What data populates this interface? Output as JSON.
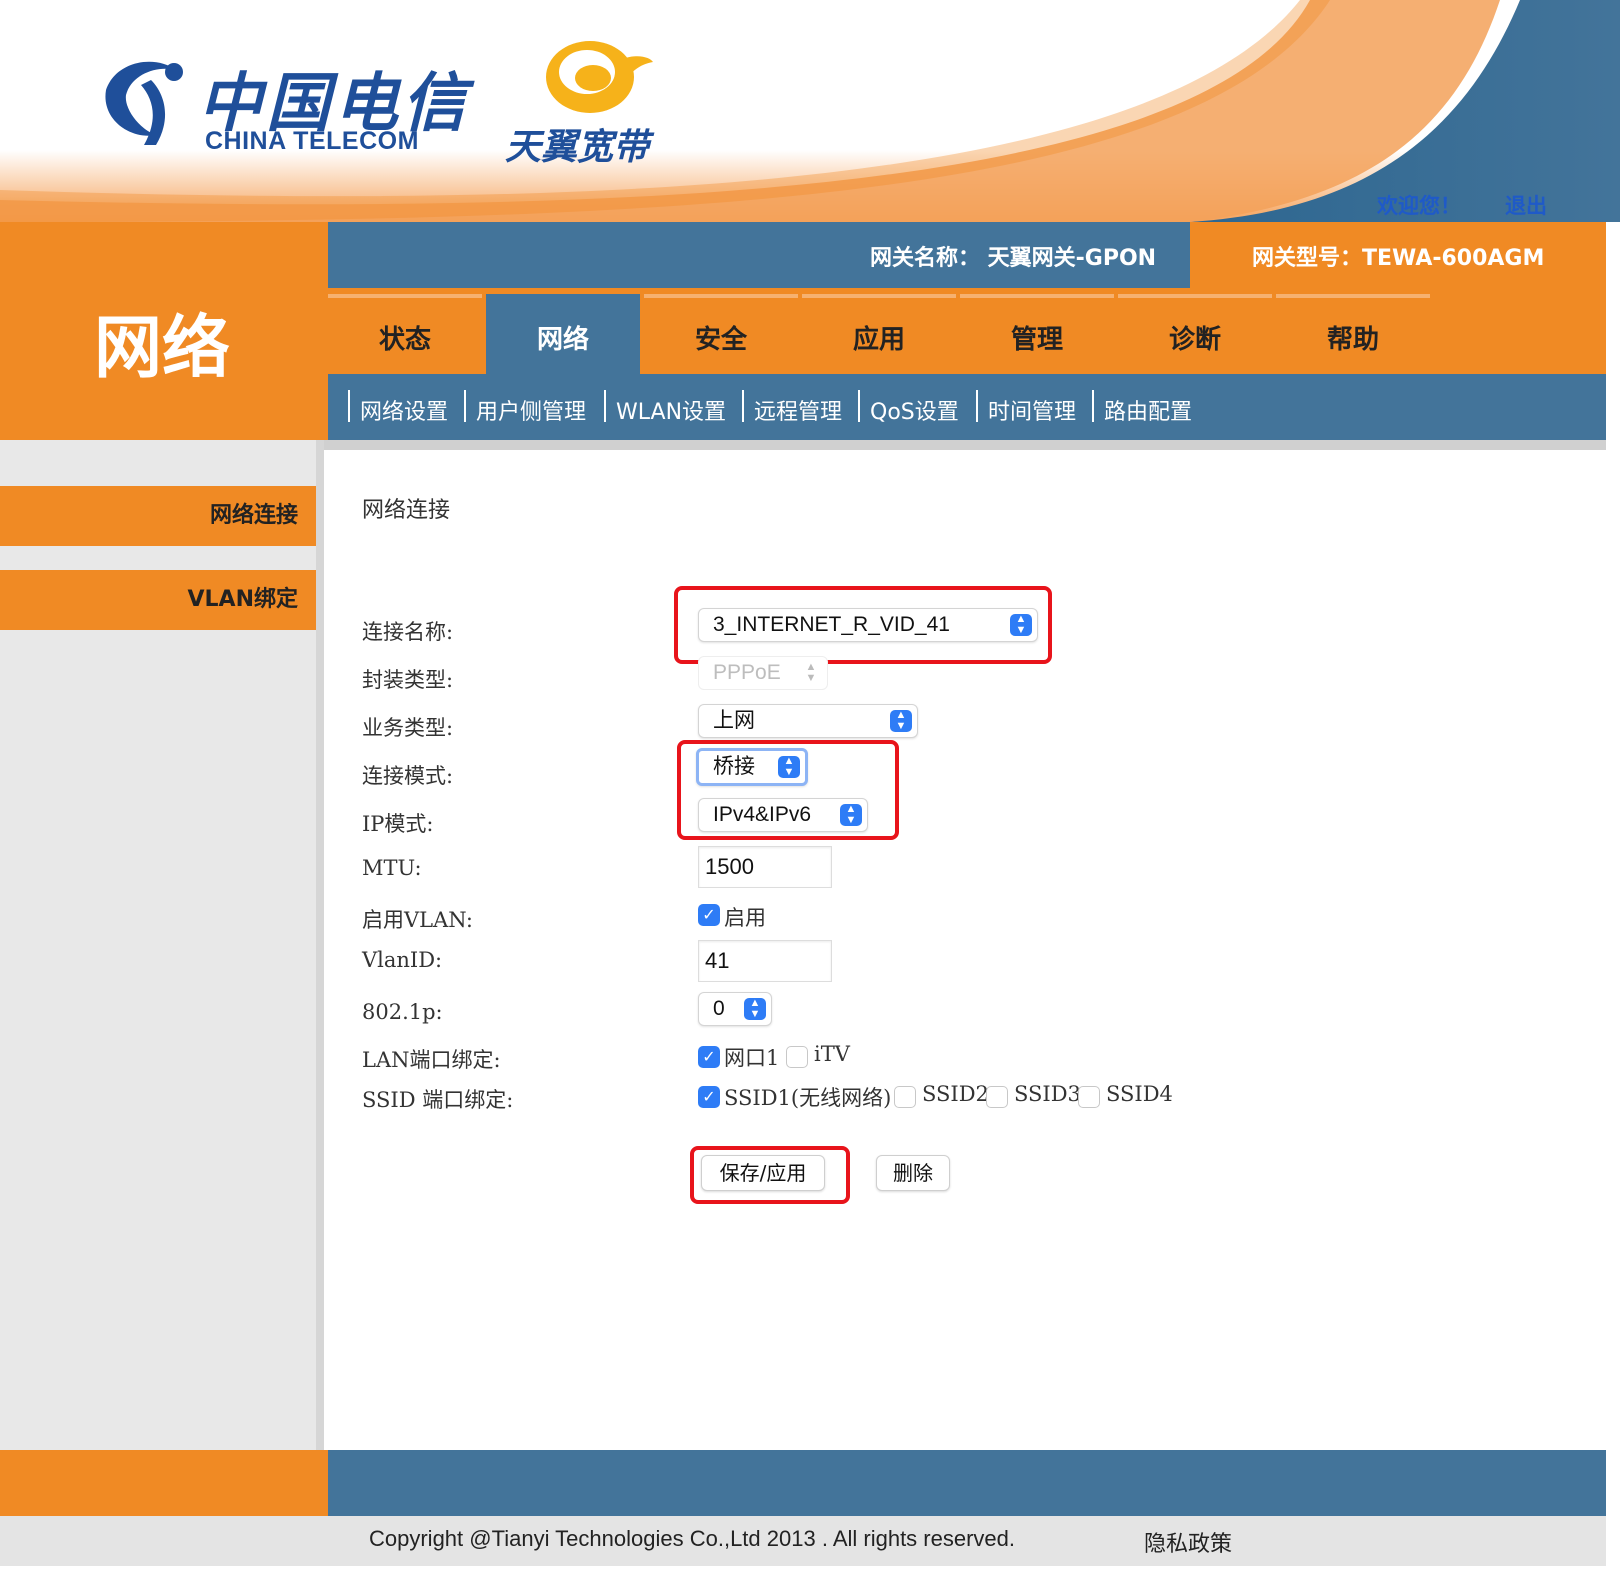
{
  "header": {
    "brand_cn": "中国电信",
    "brand_en": "CHINA TELECOM",
    "brand_sub": "天翼宽带",
    "welcome": "欢迎您！",
    "logout": "退出"
  },
  "info_bar": {
    "gateway_name": "网关名称：  天翼网关-GPON",
    "gateway_model": "网关型号：TEWA-600AGM"
  },
  "section_title": "网络",
  "tabs": [
    {
      "label": "状态"
    },
    {
      "label": "网络"
    },
    {
      "label": "安全"
    },
    {
      "label": "应用"
    },
    {
      "label": "管理"
    },
    {
      "label": "诊断"
    },
    {
      "label": "帮助"
    }
  ],
  "subnav": [
    {
      "label": "网络设置"
    },
    {
      "label": "用户侧管理"
    },
    {
      "label": "WLAN设置"
    },
    {
      "label": "远程管理"
    },
    {
      "label": "QoS设置"
    },
    {
      "label": "时间管理"
    },
    {
      "label": "路由配置"
    }
  ],
  "sidebar": [
    {
      "label": "网络连接"
    },
    {
      "label": "VLAN绑定"
    }
  ],
  "form": {
    "heading": "网络连接",
    "connection_name": {
      "label": "连接名称:",
      "value": "3_INTERNET_R_VID_41"
    },
    "encap_type": {
      "label": "封装类型:",
      "value": "PPPoE"
    },
    "service_type": {
      "label": "业务类型:",
      "value": "上网"
    },
    "connection_mode": {
      "label": "连接模式:",
      "value": "桥接"
    },
    "ip_mode": {
      "label": "IP模式:",
      "value": "IPv4&IPv6"
    },
    "mtu": {
      "label": "MTU:",
      "value": "1500"
    },
    "enable_vlan": {
      "label": "启用VLAN:",
      "option": "启用",
      "checked": true
    },
    "vlan_id": {
      "label": "VlanID:",
      "value": "41"
    },
    "p8021": {
      "label": "802.1p:",
      "value": "0"
    },
    "lan_bind": {
      "label": "LAN端口绑定:",
      "options": [
        {
          "label": "网口1",
          "checked": true
        },
        {
          "label": "iTV",
          "checked": false
        }
      ]
    },
    "ssid_bind": {
      "label": "SSID 端口绑定:",
      "options": [
        {
          "label": "SSID1(无线网络)",
          "checked": true
        },
        {
          "label": "SSID2",
          "checked": false
        },
        {
          "label": "SSID3",
          "checked": false
        },
        {
          "label": "SSID4",
          "checked": false
        }
      ]
    },
    "save_label": "保存/应用",
    "delete_label": "删除"
  },
  "footer": {
    "copyright": "Copyright @Tianyi Technologies Co.,Ltd 2013 . All rights reserved.",
    "privacy": "隐私政策"
  },
  "colors": {
    "brand_orange": "#f08a24",
    "brand_blue": "#43749a",
    "logo_blue": "#1f4f9a",
    "highlight_red": "#e8141b",
    "check_blue": "#2e7cf6"
  },
  "icons": [
    "china-telecom-logo-icon",
    "tianyi-swirl-icon",
    "select-arrow-icon",
    "checkmark-icon"
  ]
}
